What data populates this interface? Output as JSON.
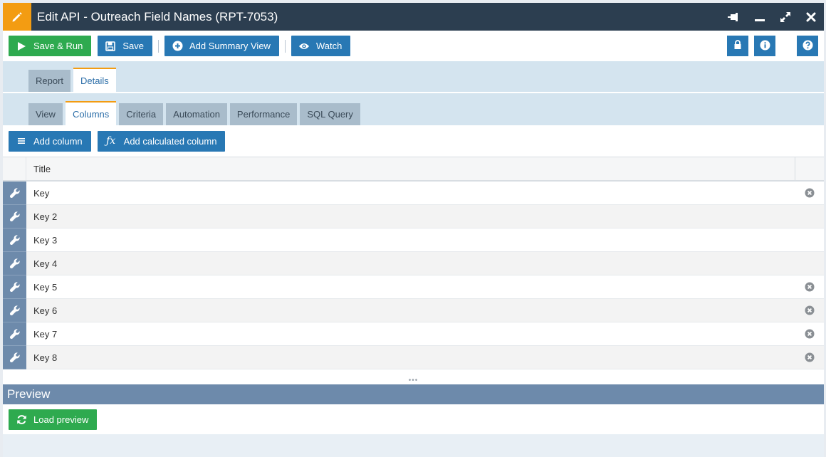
{
  "window": {
    "title": "Edit API - Outreach Field Names (RPT-7053)",
    "title_icon": "pencil-icon",
    "controls": [
      "pin-icon",
      "minimize-icon",
      "maximize-icon",
      "close-icon"
    ]
  },
  "toolbar": {
    "save_run_label": "Save & Run",
    "save_label": "Save",
    "add_summary_view_label": "Add Summary View",
    "watch_label": "Watch",
    "right_icons": [
      "lock-icon",
      "info-icon",
      "help-icon"
    ]
  },
  "tabs": {
    "top": [
      {
        "label": "Report",
        "active": false
      },
      {
        "label": "Details",
        "active": true
      }
    ],
    "sub": [
      {
        "label": "View",
        "active": false
      },
      {
        "label": "Columns",
        "active": true
      },
      {
        "label": "Criteria",
        "active": false
      },
      {
        "label": "Automation",
        "active": false
      },
      {
        "label": "Performance",
        "active": false
      },
      {
        "label": "SQL Query",
        "active": false
      }
    ]
  },
  "columns": {
    "add_column_label": "Add column",
    "add_calculated_label": "Add calculated column",
    "header_title": "Title",
    "rows": [
      {
        "title": "Key",
        "removable": true
      },
      {
        "title": "Key 2",
        "removable": false
      },
      {
        "title": "Key 3",
        "removable": false
      },
      {
        "title": "Key 4",
        "removable": false
      },
      {
        "title": "Key 5",
        "removable": true
      },
      {
        "title": "Key 6",
        "removable": true
      },
      {
        "title": "Key 7",
        "removable": true
      },
      {
        "title": "Key 8",
        "removable": true
      }
    ]
  },
  "preview": {
    "heading": "Preview",
    "load_label": "Load preview"
  },
  "colors": {
    "accent_orange": "#f39c12",
    "titlebar": "#2c3e50",
    "primary_blue": "#2878b4",
    "success_green": "#2eaa4f",
    "slate": "#6d8aab"
  }
}
